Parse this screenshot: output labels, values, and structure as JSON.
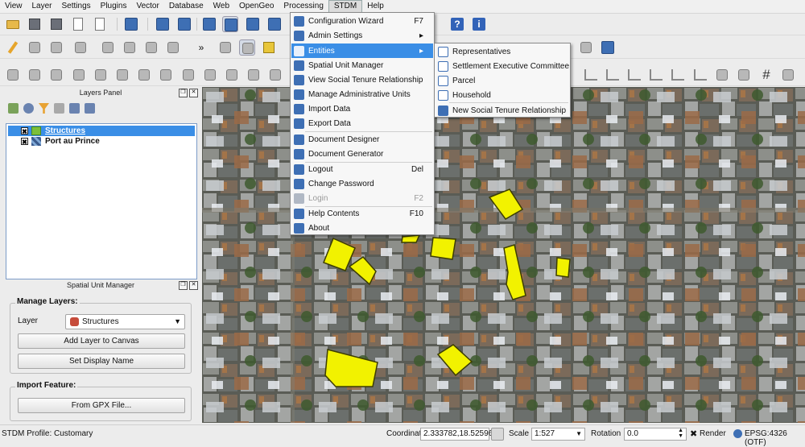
{
  "menubar": [
    "View",
    "Layer",
    "Settings",
    "Plugins",
    "Vector",
    "Database",
    "Web",
    "OpenGeo",
    "Processing",
    "STDM",
    "Help"
  ],
  "stdm_menu": {
    "items": [
      {
        "label": "Configuration Wizard",
        "shortcut": "F7",
        "icon": "wizard-icon",
        "color": "#3e6fb4"
      },
      {
        "label": "Admin Settings",
        "shortcut": "▸",
        "icon": "admin-settings-icon",
        "color": "#3e6fb4"
      },
      {
        "label": "Entities",
        "shortcut": "▸",
        "icon": "entities-icon",
        "color": "#3a6fb8"
      },
      {
        "label": "Spatial Unit Manager",
        "shortcut": "",
        "icon": "spatial-unit-icon",
        "color": "#3e6fb4"
      },
      {
        "label": "View Social Tenure Relationship",
        "shortcut": "",
        "icon": "tenure-icon",
        "color": "#3e6fb4"
      },
      {
        "label": "Manage Administrative Units",
        "shortcut": "",
        "icon": "admin-units-icon",
        "color": "#3e6fb4"
      },
      {
        "label": "Import Data",
        "shortcut": "",
        "icon": "import-icon",
        "color": "#3e6fb4"
      },
      {
        "label": "Export Data",
        "shortcut": "",
        "icon": "export-icon",
        "color": "#3e6fb4"
      },
      {
        "label": "Document Designer",
        "shortcut": "",
        "icon": "document-designer-icon",
        "color": "#3e6fb4"
      },
      {
        "label": "Document Generator",
        "shortcut": "",
        "icon": "document-generator-icon",
        "color": "#3e6fb4"
      },
      {
        "label": "Logout",
        "shortcut": "Del",
        "icon": "logout-icon",
        "color": "#3e6fb4"
      },
      {
        "label": "Change Password",
        "shortcut": "",
        "icon": "password-icon",
        "color": "#3e6fb4"
      },
      {
        "label": "Login",
        "shortcut": "F2",
        "icon": "login-icon",
        "color": "#b0b8c4"
      },
      {
        "label": "Help Contents",
        "shortcut": "F10",
        "icon": "help-contents-icon",
        "color": "#3e6fb4"
      },
      {
        "label": "About",
        "shortcut": "",
        "icon": "about-icon",
        "color": "#3e6fb4"
      }
    ]
  },
  "entities_submenu": [
    {
      "label": "Representatives",
      "icon": "table-icon"
    },
    {
      "label": "Settlement Executive Committee",
      "icon": "table-icon"
    },
    {
      "label": "Parcel",
      "icon": "table-icon"
    },
    {
      "label": "Household",
      "icon": "table-icon"
    },
    {
      "label": "New Social Tenure Relationship",
      "icon": "tenure-icon"
    }
  ],
  "layers_panel": {
    "title": "Layers Panel",
    "layers": [
      {
        "name": "Structures",
        "checked": "✖",
        "swatch": "#7bbf3a"
      },
      {
        "name": "Port au Prince",
        "checked": "✖",
        "swatch": "#3b5b8e"
      }
    ]
  },
  "spatial_unit_manager": {
    "title": "Spatial Unit Manager",
    "manage_layers_title": "Manage Layers:",
    "layer_label": "Layer",
    "layer_value": "Structures",
    "add_layer_button": "Add Layer to Canvas",
    "set_display_name_button": "Set Display Name",
    "import_feature_title": "Import Feature:",
    "gpx_button": "From GPX File..."
  },
  "statusbar": {
    "profile": "STDM Profile: Customary",
    "coordinate_label": "Coordinate",
    "coordinate_value": "2.333782,18.525960",
    "scale_label": "Scale",
    "scale_value": "1:527",
    "rotation_label": "Rotation",
    "rotation_value": "0.0",
    "render_label": "Render",
    "crs": "EPSG:4326 (OTF)"
  },
  "colors": {
    "highlight": "#3a8ee6",
    "structure_fill": "#f2f200",
    "structure_stroke": "#3d3d00"
  }
}
